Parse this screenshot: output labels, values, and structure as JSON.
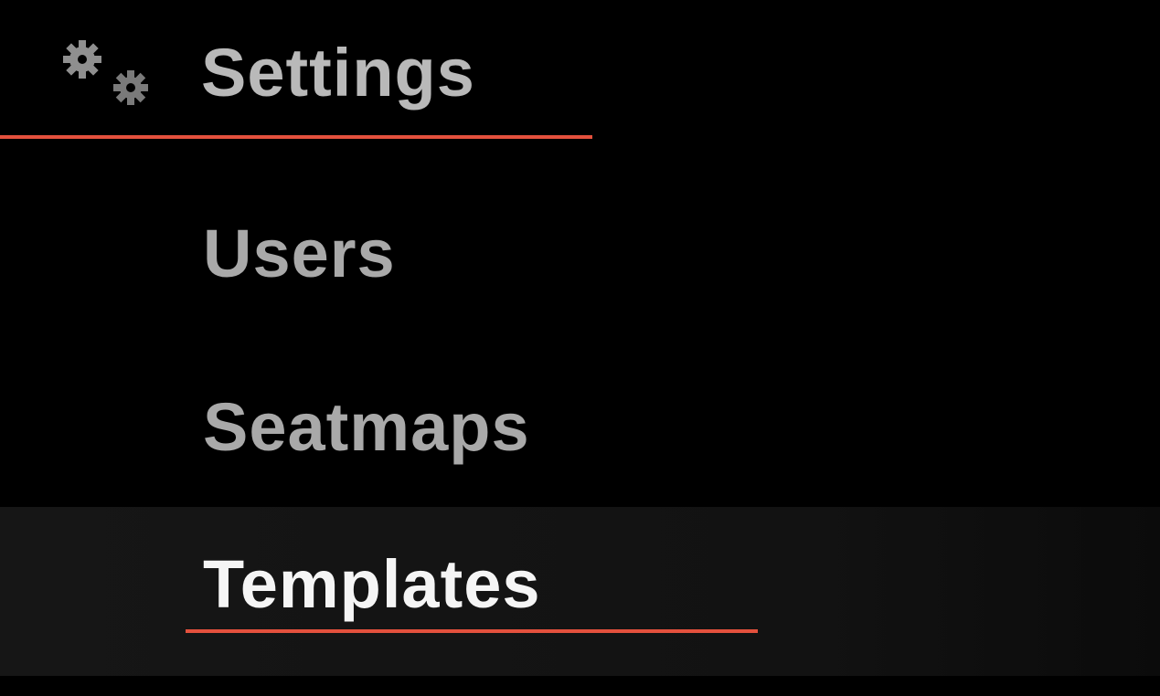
{
  "menu": {
    "header": {
      "label": "Settings",
      "icon": "gears-icon"
    },
    "items": [
      {
        "label": "Users",
        "active": false
      },
      {
        "label": "Seatmaps",
        "active": false
      },
      {
        "label": "Templates",
        "active": true
      }
    ]
  },
  "colors": {
    "background": "#000000",
    "accent_underline": "#e4513d",
    "active_item_background": "#151515",
    "inactive_text": "#a9a9a9",
    "active_text": "#f5f5f5"
  }
}
